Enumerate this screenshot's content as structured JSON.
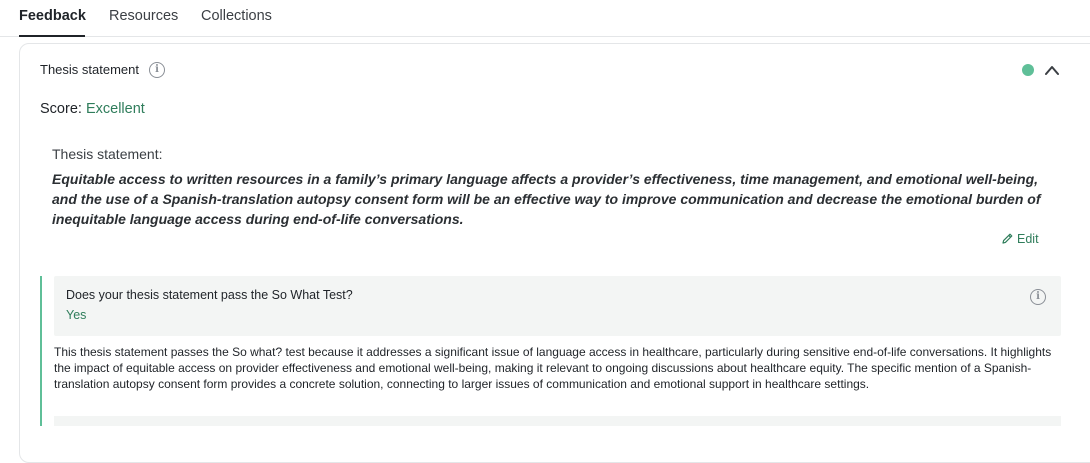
{
  "tabs": [
    {
      "label": "Feedback",
      "active": true
    },
    {
      "label": "Resources",
      "active": false
    },
    {
      "label": "Collections",
      "active": false
    }
  ],
  "card": {
    "title": "Thesis statement",
    "status_color": "#5fbf98",
    "score_label": "Score:",
    "score_value": "Excellent",
    "thesis_label": "Thesis statement:",
    "thesis_text": "Equitable access to written resources in a family’s primary language affects a provider’s effectiveness, time management, and emotional well-being, and the use of a Spanish-translation autopsy consent form will be an effective way to improve communication and decrease the emotional burden of inequitable language access during end-of-life conversations.",
    "edit_label": "Edit"
  },
  "criterion": {
    "question": "Does your thesis statement pass the So What Test?",
    "answer": "Yes",
    "explanation": "This thesis statement passes the So what? test because it addresses a significant issue of language access in healthcare, particularly during sensitive end-of-life conversations. It highlights the impact of equitable access on provider effectiveness and emotional well-being, making it relevant to ongoing discussions about healthcare equity. The specific mention of a Spanish-translation autopsy consent form provides a concrete solution, connecting to larger issues of communication and emotional support in healthcare settings."
  },
  "icons": {
    "info": "info-icon",
    "collapse": "chevron-up-icon",
    "edit": "pencil-icon"
  },
  "colors": {
    "accent": "#2f7d5b",
    "status": "#5fbf98"
  }
}
